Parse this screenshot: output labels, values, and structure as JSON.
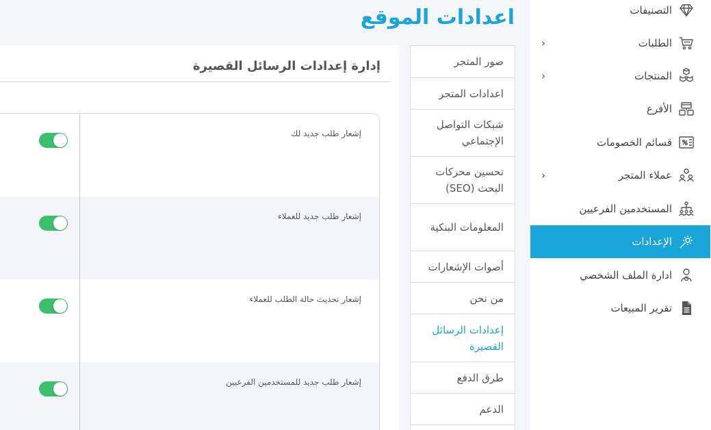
{
  "page_title": "اعدادات الموقع",
  "sidebar": {
    "items": [
      {
        "label": "التصنيفات",
        "icon": "diamond-icon",
        "chevron": false,
        "active": false
      },
      {
        "label": "الطلبات",
        "icon": "cart-icon",
        "chevron": true,
        "active": false
      },
      {
        "label": "المنتجات",
        "icon": "boxes-icon",
        "chevron": true,
        "active": false
      },
      {
        "label": "الأفرع",
        "icon": "branches-icon",
        "chevron": false,
        "active": false
      },
      {
        "label": "قسائم الخصومات",
        "icon": "coupon-icon",
        "chevron": false,
        "active": false
      },
      {
        "label": "عملاء المتجر",
        "icon": "customers-icon",
        "chevron": true,
        "active": false
      },
      {
        "label": "المستخدمين الفرعيين",
        "icon": "org-chart-icon",
        "chevron": false,
        "active": false
      },
      {
        "label": "الإعدادات",
        "icon": "settings-gear-icon",
        "chevron": false,
        "active": true
      },
      {
        "label": "ادارة الملف الشخصي",
        "icon": "profile-icon",
        "chevron": false,
        "active": false
      },
      {
        "label": "تقرير المبيعات",
        "icon": "report-icon",
        "chevron": false,
        "active": false
      }
    ],
    "chevron_glyph": "‹"
  },
  "tabs": [
    {
      "label": "صور المتجر",
      "active": false
    },
    {
      "label": "اعدادات المتجر",
      "active": false
    },
    {
      "label": "شبكات التواصل الإجتماعي",
      "active": false
    },
    {
      "label": "تحسين محركات البحث (SEO)",
      "active": false
    },
    {
      "label": "المعلومات البنكية",
      "active": false
    },
    {
      "label": "أصوات الإشعارات",
      "active": false
    },
    {
      "label": "من نحن",
      "active": false
    },
    {
      "label": "إعدادات الرسائل القصيرة",
      "active": true
    },
    {
      "label": "طرق الدفع",
      "active": false
    },
    {
      "label": "الدعم",
      "active": false
    }
  ],
  "panel": {
    "title": "إدارة إعدادات الرسائل القصيرة",
    "settings": [
      {
        "label": "إشعار طلب جديد لك",
        "enabled": true
      },
      {
        "label": "إشعار طلب جديد للعملاء",
        "enabled": true
      },
      {
        "label": "إشعار تحديث حالة الطلب للعملاء",
        "enabled": true
      },
      {
        "label": "إشعار طلب جديد للمستخدمين الفرعيين",
        "enabled": true
      }
    ]
  },
  "colors": {
    "accent": "#1aa5d8",
    "toggle_on": "#3cc06b",
    "background": "#f5f6fa"
  }
}
